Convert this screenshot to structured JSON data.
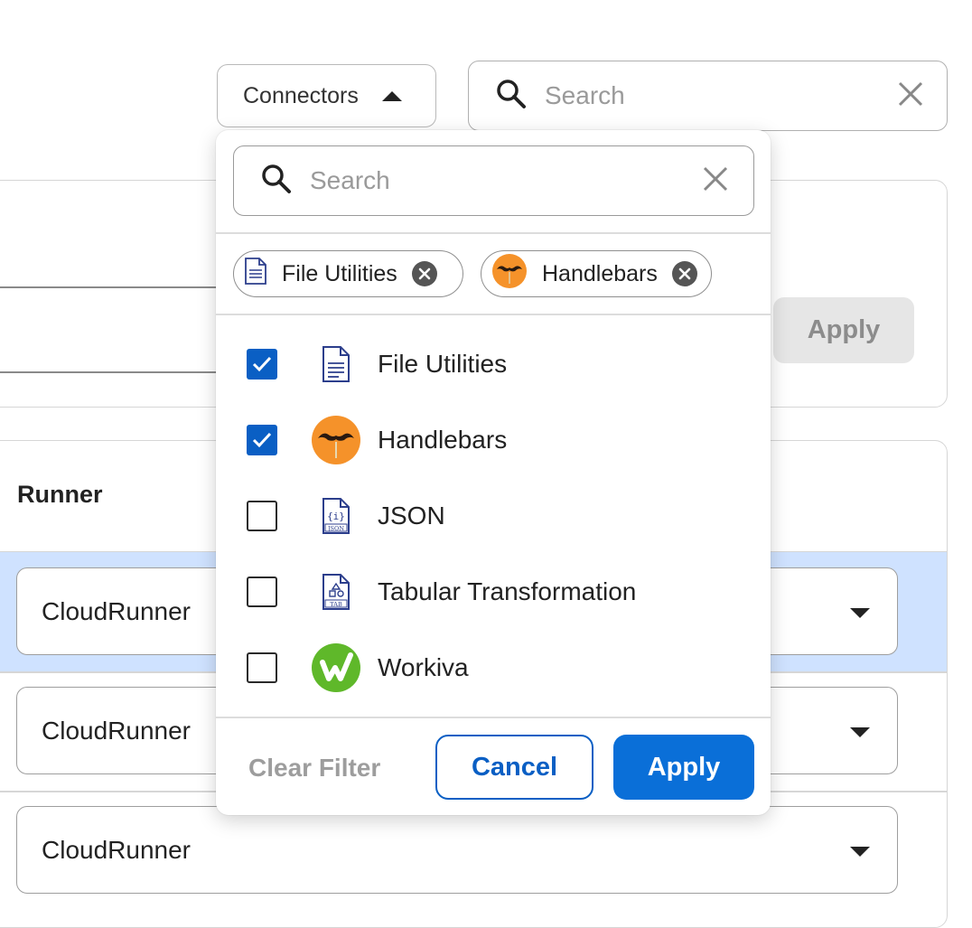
{
  "toolbar": {
    "connectors_label": "Connectors",
    "search_placeholder": "Search"
  },
  "filter_panel": {
    "apply_label": "Apply"
  },
  "table": {
    "runner_header": "Runner",
    "rows": [
      {
        "runner": "CloudRunner",
        "selected": true
      },
      {
        "runner": "CloudRunner",
        "selected": false
      },
      {
        "runner": "CloudRunner",
        "selected": false
      }
    ]
  },
  "popover": {
    "search_placeholder": "Search",
    "chips": [
      {
        "label": "File Utilities",
        "icon": "document-icon"
      },
      {
        "label": "Handlebars",
        "icon": "mustache-icon"
      }
    ],
    "options": [
      {
        "label": "File Utilities",
        "checked": true,
        "icon": "document-icon"
      },
      {
        "label": "Handlebars",
        "checked": true,
        "icon": "mustache-icon"
      },
      {
        "label": "JSON",
        "checked": false,
        "icon": "json-file-icon"
      },
      {
        "label": "Tabular Transformation",
        "checked": false,
        "icon": "tab-file-icon"
      },
      {
        "label": "Workiva",
        "checked": false,
        "icon": "workiva-logo-icon"
      }
    ],
    "clear_filter_label": "Clear Filter",
    "cancel_label": "Cancel",
    "apply_label": "Apply",
    "accent_color": "#0a5fc4",
    "handlebars_color": "#f5922a",
    "workiva_color": "#5fb82a"
  }
}
